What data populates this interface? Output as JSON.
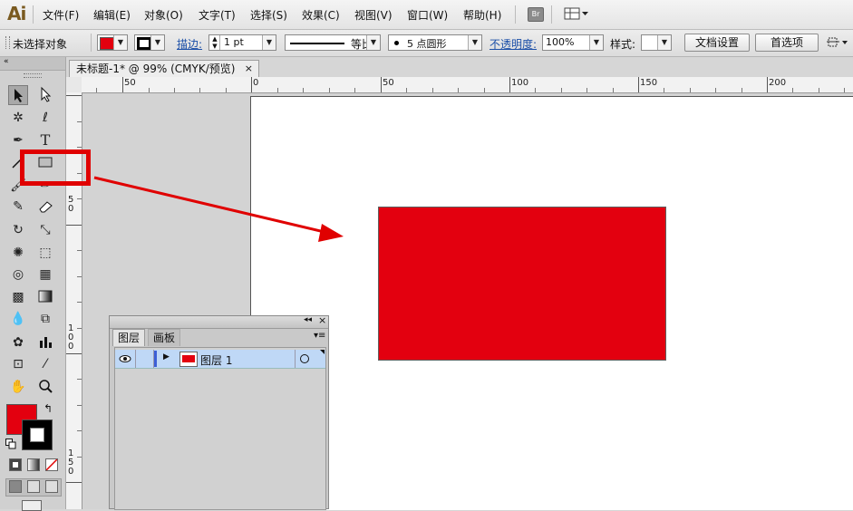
{
  "app": {
    "logo": "Ai"
  },
  "menu": [
    "文件(F)",
    "编辑(E)",
    "对象(O)",
    "文字(T)",
    "选择(S)",
    "效果(C)",
    "视图(V)",
    "窗口(W)",
    "帮助(H)"
  ],
  "menu_extras": {
    "bridge_label": "Br"
  },
  "control_bar": {
    "selection_status": "未选择对象",
    "stroke_label": "描边:",
    "stroke_weight": "1 pt",
    "stroke_profile": "等比",
    "brush": "5 点圆形",
    "opacity_label": "不透明度:",
    "opacity_value": "100%",
    "style_label": "样式:",
    "doc_setup_button": "文档设置",
    "preferences_button": "首选项",
    "fill_color": "#e3000f"
  },
  "document": {
    "tab_title": "未标题-1* @ 99% (CMYK/预览)",
    "close_glyph": "×"
  },
  "ruler": {
    "h_labels": [
      "50",
      "0",
      "50",
      "100",
      "150",
      "200"
    ],
    "v_labels": [
      "5\n0",
      "1\n0\n0",
      "1\n5\n0"
    ]
  },
  "canvas": {
    "rect_fill": "#e3000f"
  },
  "toolbar": {
    "fill_color": "#e3000f",
    "stroke_color": "#000000"
  },
  "layers_panel": {
    "tabs": [
      "图层",
      "画板"
    ],
    "layers": [
      {
        "name": "图层 1",
        "color": "#e3000f"
      }
    ]
  },
  "annotation": {
    "color": "#e00000"
  }
}
